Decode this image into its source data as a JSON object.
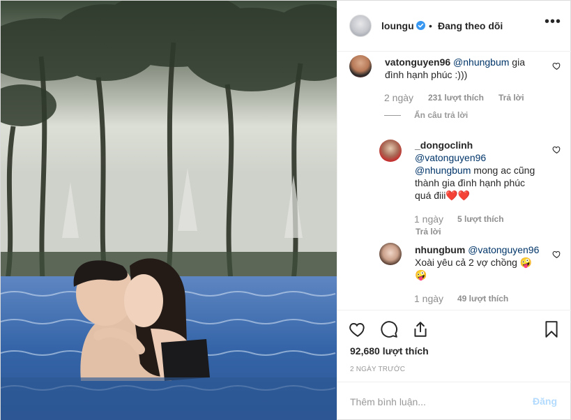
{
  "header": {
    "username": "loungu",
    "separator": "•",
    "follow_status": "Đang theo dõi",
    "more_label": "•••"
  },
  "comments": [
    {
      "username": "vatonguyen96",
      "mention": "@nhungbum",
      "text_line1_rest": " gia",
      "text_line2": "đình hạnh phúc :)))",
      "time": "2 ngày",
      "likes": "231 lượt thích",
      "reply": "Trả lời"
    },
    {
      "username": "_dongoclinh",
      "mention1": "@vatonguyen96",
      "mention2": "@nhungbum",
      "text_line3_rest": " mong ac cũng",
      "text_line4": "thành gia đình hạnh phúc",
      "text_line5": "quá điii❤️❤️",
      "time": "1 ngày",
      "likes": "5 lượt thích",
      "reply": "Trả lời"
    },
    {
      "username": "nhungbum",
      "mention": "@vatonguyen96",
      "text_line2": "Xoài yêu cả 2 vợ chồng 🤪",
      "text_line3": "🤪",
      "time": "1 ngày",
      "likes": "49 lượt thích"
    }
  ],
  "hide_replies": "Ẩn câu trả lời",
  "post": {
    "likes": "92,680 lượt thích",
    "date": "2 NGÀY TRƯỚC"
  },
  "add_comment": {
    "placeholder": "Thêm bình luận...",
    "post_label": "Đăng"
  },
  "icons": {
    "verified": "verified-badge-icon",
    "like": "heart-icon",
    "comment": "comment-bubble-icon",
    "share": "share-icon",
    "save": "bookmark-icon",
    "more": "more-options-icon"
  },
  "colors": {
    "verified": "#3897f0",
    "mention": "#003569",
    "muted": "#8e8e8e",
    "post_button_disabled": "#b3dbff"
  }
}
